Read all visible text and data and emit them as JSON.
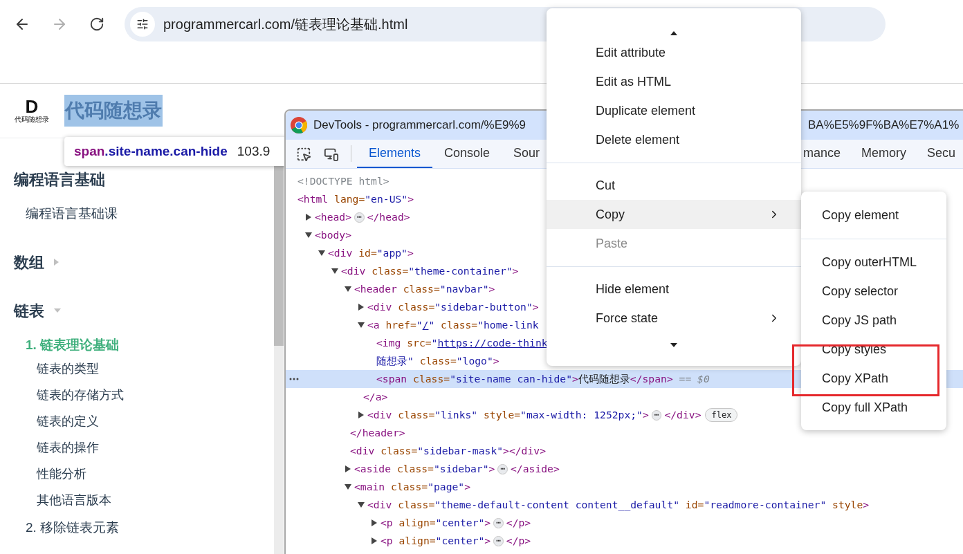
{
  "browser": {
    "address": "programmercarl.com/链表理论基础.html",
    "back_disabled": false,
    "forward_disabled": true
  },
  "site": {
    "logo_mark": "D",
    "logo_caption": "代码随想录",
    "name": "代码随想录",
    "name_highlighted": true
  },
  "tooltip": {
    "tag": "span",
    "classes": ".site-name.can-hide",
    "size": "103.9"
  },
  "sidebar": {
    "sections": [
      {
        "title": "编程语言基础",
        "kind": "plain",
        "items": [
          {
            "label": "编程语言基础课",
            "selected": false
          }
        ]
      },
      {
        "title": "数组",
        "kind": "toggle",
        "expanded": false
      },
      {
        "title": "链表",
        "kind": "toggle",
        "expanded": true,
        "items": [
          {
            "label": "1. 链表理论基础",
            "selected": true,
            "children": [
              {
                "label": "链表的类型",
                "selected": false
              },
              {
                "label": "链表的存储方式",
                "selected": false
              },
              {
                "label": "链表的定义",
                "selected": false
              },
              {
                "label": "链表的操作",
                "selected": false
              },
              {
                "label": "性能分析",
                "selected": false
              },
              {
                "label": "其他语言版本",
                "selected": false
              }
            ]
          },
          {
            "label": "2. 移除链表元素",
            "selected": false
          }
        ]
      }
    ]
  },
  "devtools": {
    "title_left": "DevTools - programmercarl.com/%E9%9",
    "title_right": "BA%E5%9F%BA%E7%A1%",
    "tabs_left": [
      {
        "label": "Elements",
        "selected": true
      },
      {
        "label": "Console",
        "selected": false
      },
      {
        "label": "Sour",
        "selected": false
      }
    ],
    "tabs_right": [
      {
        "label": "mance",
        "selected": false
      },
      {
        "label": "Memory",
        "selected": false
      },
      {
        "label": "Secu",
        "selected": false
      }
    ],
    "tree": [
      {
        "selected": false,
        "lines": [
          [
            {
              "kind": "comment",
              "s": "<!DOCTYPE html>"
            }
          ]
        ]
      },
      {
        "selected": false,
        "lines": [
          [
            {
              "kind": "tag",
              "s": "<html"
            },
            {
              "kind": "attr",
              "s": " lang="
            },
            {
              "kind": "value",
              "s": "\"en-US\""
            },
            {
              "kind": "tag",
              "s": ">"
            }
          ]
        ],
        "children": [
          {
            "selected": false,
            "expanded": false,
            "lines": [
              [
                {
                  "kind": "tag",
                  "s": "<head>"
                },
                {
                  "kind": "ellipsis",
                  "s": "⋯"
                },
                {
                  "kind": "tag",
                  "s": "</head>"
                }
              ]
            ]
          },
          {
            "selected": false,
            "expanded": true,
            "lines": [
              [
                {
                  "kind": "tag",
                  "s": "<body>"
                }
              ]
            ],
            "children": [
              {
                "selected": false,
                "expanded": true,
                "lines": [
                  [
                    {
                      "kind": "tag",
                      "s": "<div"
                    },
                    {
                      "kind": "attr",
                      "s": " id="
                    },
                    {
                      "kind": "value",
                      "s": "\"app\""
                    },
                    {
                      "kind": "tag",
                      "s": ">"
                    }
                  ]
                ],
                "children": [
                  {
                    "selected": false,
                    "expanded": true,
                    "lines": [
                      [
                        {
                          "kind": "tag",
                          "s": "<div"
                        },
                        {
                          "kind": "attr",
                          "s": " class="
                        },
                        {
                          "kind": "value",
                          "s": "\"theme-container\""
                        },
                        {
                          "kind": "tag",
                          "s": ">"
                        }
                      ]
                    ],
                    "children": [
                      {
                        "selected": false,
                        "expanded": true,
                        "lines": [
                          [
                            {
                              "kind": "tag",
                              "s": "<header"
                            },
                            {
                              "kind": "attr",
                              "s": " class="
                            },
                            {
                              "kind": "value",
                              "s": "\"navbar\""
                            },
                            {
                              "kind": "tag",
                              "s": ">"
                            }
                          ]
                        ],
                        "close": [
                          {
                            "kind": "tag",
                            "s": "</header>"
                          }
                        ],
                        "children": [
                          {
                            "selected": false,
                            "expanded": false,
                            "lines": [
                              [
                                {
                                  "kind": "tag",
                                  "s": "<div"
                                },
                                {
                                  "kind": "attr",
                                  "s": " class="
                                },
                                {
                                  "kind": "value",
                                  "s": "\"sidebar-button\""
                                },
                                {
                                  "kind": "tag",
                                  "s": ">"
                                }
                              ]
                            ]
                          },
                          {
                            "selected": false,
                            "expanded": true,
                            "lines": [
                              [
                                {
                                  "kind": "tag",
                                  "s": "<a"
                                },
                                {
                                  "kind": "attr",
                                  "s": " href="
                                },
                                {
                                  "kind": "value",
                                  "s": "\""
                                },
                                {
                                  "kind": "link",
                                  "s": "/"
                                },
                                {
                                  "kind": "value",
                                  "s": "\""
                                },
                                {
                                  "kind": "attr",
                                  "s": " class="
                                },
                                {
                                  "kind": "value",
                                  "s": "\"home-link"
                                }
                              ]
                            ],
                            "close": [
                              {
                                "kind": "tag",
                                "s": "</a>"
                              }
                            ],
                            "children": [
                              {
                                "selected": false,
                                "lines": [
                                  [
                                    {
                                      "kind": "tag",
                                      "s": "<img"
                                    },
                                    {
                                      "kind": "attr",
                                      "s": " src="
                                    },
                                    {
                                      "kind": "value",
                                      "s": "\""
                                    },
                                    {
                                      "kind": "link",
                                      "s": "https://code-think"
                                    }
                                  ],
                                  [
                                    {
                                      "kind": "value",
                                      "s": "随想录\""
                                    },
                                    {
                                      "kind": "attr",
                                      "s": " class="
                                    },
                                    {
                                      "kind": "value",
                                      "s": "\"logo\""
                                    },
                                    {
                                      "kind": "tag",
                                      "s": ">"
                                    }
                                  ]
                                ]
                              },
                              {
                                "selected": true,
                                "lines": [
                                  [
                                    {
                                      "kind": "tag",
                                      "s": "<span"
                                    },
                                    {
                                      "kind": "attr",
                                      "s": " class="
                                    },
                                    {
                                      "kind": "value",
                                      "s": "\"site-name can-hide\""
                                    },
                                    {
                                      "kind": "tag",
                                      "s": ">"
                                    },
                                    {
                                      "kind": "text",
                                      "s": "代码随想录"
                                    },
                                    {
                                      "kind": "tag",
                                      "s": "</span>"
                                    },
                                    {
                                      "kind": "hint",
                                      "s": " == $0"
                                    }
                                  ]
                                ]
                              }
                            ]
                          },
                          {
                            "selected": false,
                            "expanded": false,
                            "lines": [
                              [
                                {
                                  "kind": "tag",
                                  "s": "<div"
                                },
                                {
                                  "kind": "attr",
                                  "s": " class="
                                },
                                {
                                  "kind": "value",
                                  "s": "\"links\""
                                },
                                {
                                  "kind": "attr",
                                  "s": " style="
                                },
                                {
                                  "kind": "value",
                                  "s": "\"max-width: 1252px;\""
                                },
                                {
                                  "kind": "tag",
                                  "s": ">"
                                },
                                {
                                  "kind": "ellipsis",
                                  "s": "⋯"
                                },
                                {
                                  "kind": "tag",
                                  "s": "</div>"
                                },
                                {
                                  "kind": "badge",
                                  "s": "flex"
                                }
                              ]
                            ]
                          }
                        ]
                      },
                      {
                        "selected": false,
                        "lines": [
                          [
                            {
                              "kind": "tag",
                              "s": "<div"
                            },
                            {
                              "kind": "attr",
                              "s": " class="
                            },
                            {
                              "kind": "value",
                              "s": "\"sidebar-mask\""
                            },
                            {
                              "kind": "tag",
                              "s": "></div>"
                            }
                          ]
                        ]
                      },
                      {
                        "selected": false,
                        "expanded": false,
                        "lines": [
                          [
                            {
                              "kind": "tag",
                              "s": "<aside"
                            },
                            {
                              "kind": "attr",
                              "s": " class="
                            },
                            {
                              "kind": "value",
                              "s": "\"sidebar\""
                            },
                            {
                              "kind": "tag",
                              "s": ">"
                            },
                            {
                              "kind": "ellipsis",
                              "s": "⋯"
                            },
                            {
                              "kind": "tag",
                              "s": "</aside>"
                            }
                          ]
                        ]
                      },
                      {
                        "selected": false,
                        "expanded": true,
                        "lines": [
                          [
                            {
                              "kind": "tag",
                              "s": "<main"
                            },
                            {
                              "kind": "attr",
                              "s": " class="
                            },
                            {
                              "kind": "value",
                              "s": "\"page\""
                            },
                            {
                              "kind": "tag",
                              "s": ">"
                            }
                          ]
                        ],
                        "children": [
                          {
                            "selected": false,
                            "expanded": true,
                            "lines": [
                              [
                                {
                                  "kind": "tag",
                                  "s": "<div"
                                },
                                {
                                  "kind": "attr",
                                  "s": " class="
                                },
                                {
                                  "kind": "value",
                                  "s": "\"theme-default-content content__default\""
                                },
                                {
                                  "kind": "attr",
                                  "s": " id="
                                },
                                {
                                  "kind": "value",
                                  "s": "\"readmore-container\""
                                },
                                {
                                  "kind": "attr",
                                  "s": " style"
                                },
                                {
                                  "kind": "tag",
                                  "s": ">"
                                }
                              ]
                            ],
                            "children": [
                              {
                                "selected": false,
                                "expanded": false,
                                "lines": [
                                  [
                                    {
                                      "kind": "tag",
                                      "s": "<p"
                                    },
                                    {
                                      "kind": "attr",
                                      "s": " align="
                                    },
                                    {
                                      "kind": "value",
                                      "s": "\"center\""
                                    },
                                    {
                                      "kind": "tag",
                                      "s": ">"
                                    },
                                    {
                                      "kind": "ellipsis",
                                      "s": "⋯"
                                    },
                                    {
                                      "kind": "tag",
                                      "s": "</p>"
                                    }
                                  ]
                                ]
                              },
                              {
                                "selected": false,
                                "expanded": false,
                                "lines": [
                                  [
                                    {
                                      "kind": "tag",
                                      "s": "<p"
                                    },
                                    {
                                      "kind": "attr",
                                      "s": " align="
                                    },
                                    {
                                      "kind": "value",
                                      "s": "\"center\""
                                    },
                                    {
                                      "kind": "tag",
                                      "s": ">"
                                    },
                                    {
                                      "kind": "ellipsis",
                                      "s": "⋯"
                                    },
                                    {
                                      "kind": "tag",
                                      "s": "</p>"
                                    }
                                  ]
                                ]
                              }
                            ]
                          }
                        ]
                      }
                    ]
                  }
                ]
              }
            ]
          }
        ]
      }
    ]
  },
  "context_menu": {
    "items": [
      {
        "kind": "scroll_up"
      },
      {
        "kind": "item",
        "label": "Edit attribute",
        "selected": false,
        "disabled": false,
        "submenu": false
      },
      {
        "kind": "item",
        "label": "Edit as HTML",
        "selected": false,
        "disabled": false,
        "submenu": false
      },
      {
        "kind": "item",
        "label": "Duplicate element",
        "selected": false,
        "disabled": false,
        "submenu": false
      },
      {
        "kind": "item",
        "label": "Delete element",
        "selected": false,
        "disabled": false,
        "submenu": false
      },
      {
        "kind": "separator"
      },
      {
        "kind": "item",
        "label": "Cut",
        "selected": false,
        "disabled": false,
        "submenu": false
      },
      {
        "kind": "item",
        "label": "Copy",
        "selected": true,
        "disabled": false,
        "submenu": true
      },
      {
        "kind": "item",
        "label": "Paste",
        "selected": false,
        "disabled": true,
        "submenu": false
      },
      {
        "kind": "separator"
      },
      {
        "kind": "item",
        "label": "Hide element",
        "selected": false,
        "disabled": false,
        "submenu": false
      },
      {
        "kind": "item",
        "label": "Force state",
        "selected": false,
        "disabled": false,
        "submenu": true
      },
      {
        "kind": "scroll_down"
      }
    ]
  },
  "copy_submenu": {
    "items": [
      {
        "kind": "item",
        "label": "Copy element",
        "marked": false
      },
      {
        "kind": "separator"
      },
      {
        "kind": "item",
        "label": "Copy outerHTML",
        "marked": false
      },
      {
        "kind": "item",
        "label": "Copy selector",
        "marked": false
      },
      {
        "kind": "item",
        "label": "Copy JS path",
        "marked": false
      },
      {
        "kind": "item",
        "label": "Copy styles",
        "marked": true
      },
      {
        "kind": "item",
        "label": "Copy XPath",
        "marked": true
      },
      {
        "kind": "item",
        "label": "Copy full XPath",
        "marked": false
      }
    ]
  }
}
